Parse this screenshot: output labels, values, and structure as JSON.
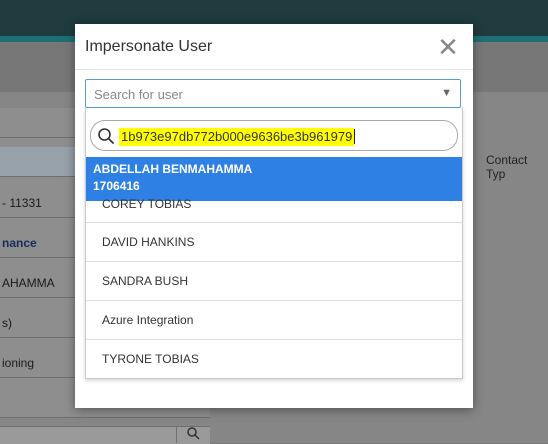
{
  "background": {
    "rows": [
      "",
      "",
      "- 11331",
      "nance",
      "AHAMMA",
      "s)",
      "ioning",
      ""
    ],
    "contact_label": "Contact Typ"
  },
  "modal": {
    "title": "Impersonate User",
    "close_symbol": "✕",
    "select_placeholder": "Search for user",
    "select_arrow": "▼",
    "search_value": "1b973e97db772b000e9636be3b961979",
    "results": [
      {
        "name": "ABDELLAH BENMAHAMMA",
        "id": "1706416",
        "selected": true
      },
      {
        "name": "COREY TOBIAS"
      },
      {
        "name": "DAVID HANKINS"
      },
      {
        "name": "SANDRA BUSH"
      },
      {
        "name": "Azure Integration"
      },
      {
        "name": "TYRONE TOBIAS"
      }
    ]
  },
  "colors": {
    "accent": "#2f80e5",
    "highlight": "#ffff00",
    "topbar": "#1f3b3e"
  }
}
